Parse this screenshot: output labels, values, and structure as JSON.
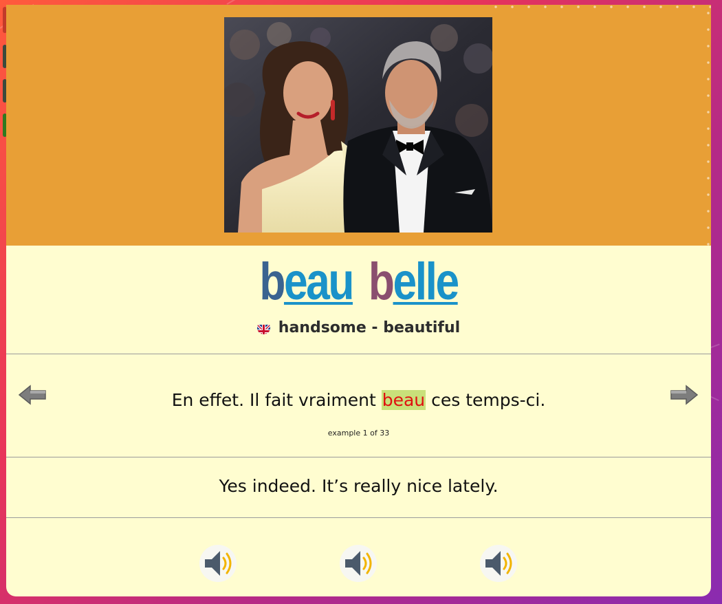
{
  "header": {
    "word_masculine": {
      "stem": "b",
      "ending": "eau"
    },
    "word_feminine": {
      "stem": "b",
      "ending": "elle"
    },
    "translation": "handsome - beautiful",
    "flag_icon": "uk-flag-icon"
  },
  "example": {
    "before": "En effet. Il fait vraiment ",
    "highlight": "beau",
    "after": " ces temps-ci.",
    "counter": "example 1 of 33",
    "english": "Yes indeed. It’s really nice lately."
  },
  "icons": {
    "prev": "arrow-left-icon",
    "next": "arrow-right-icon",
    "audio": "speaker-icon"
  },
  "colors": {
    "photo_band": "#e89f36",
    "card": "#fffdd0",
    "stem_masculine": "#3a6390",
    "stem_feminine": "#8a4f6f",
    "ending": "#1a92c9",
    "highlight_bg": "#c9e07a",
    "highlight_text": "#e01010"
  }
}
